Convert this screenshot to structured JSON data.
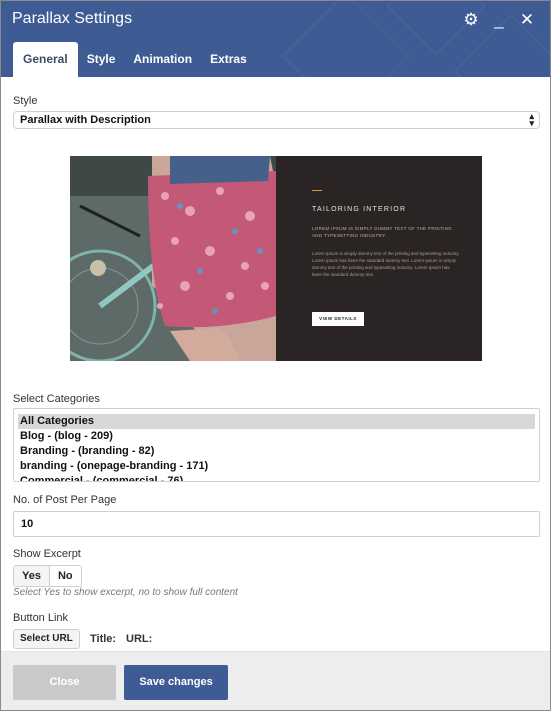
{
  "header": {
    "title": "Parallax Settings",
    "icons": [
      "gear-icon",
      "minimize-icon",
      "close-icon"
    ],
    "tabs": [
      "General",
      "Style",
      "Animation",
      "Extras"
    ],
    "active_tab": "General",
    "color": "#3f5b94"
  },
  "style_field": {
    "label": "Style",
    "value": "Parallax with Description"
  },
  "preview": {
    "title": "TAILORING INTERIOR",
    "subtitle": "LOREM IPSUM IS SIMPLY DUMMY TEXT OF THE PRINTING AND TYPESETTING INDUSTRY.",
    "body": "Lorem Ipsum is simply dummy text of the printing and typesetting industry. Lorem Ipsum has been the standard dummy text. Lorem Ipsum is simply dummy text of the printing and typesetting industry. Lorem Ipsum has been the standard dummy text.",
    "button": "VIEW DETAILS",
    "accent_color": "#d79a3d"
  },
  "categories": {
    "label": "Select Categories",
    "options": [
      "All Categories",
      "Blog - (blog - 209)",
      "Branding - (branding - 82)",
      "branding - (onepage-branding - 171)",
      "Commercial - (commercial - 76)"
    ],
    "selected": "All Categories"
  },
  "posts_per_page": {
    "label": "No. of Post Per Page",
    "value": "10"
  },
  "show_excerpt": {
    "label": "Show Excerpt",
    "yes": "Yes",
    "no": "No",
    "help": "Select Yes to show excerpt, no to show full content"
  },
  "button_link": {
    "label": "Button Link",
    "select_url": "Select URL",
    "title_label": "Title:",
    "url_label": "URL:"
  },
  "footer": {
    "close": "Close",
    "save": "Save changes"
  }
}
